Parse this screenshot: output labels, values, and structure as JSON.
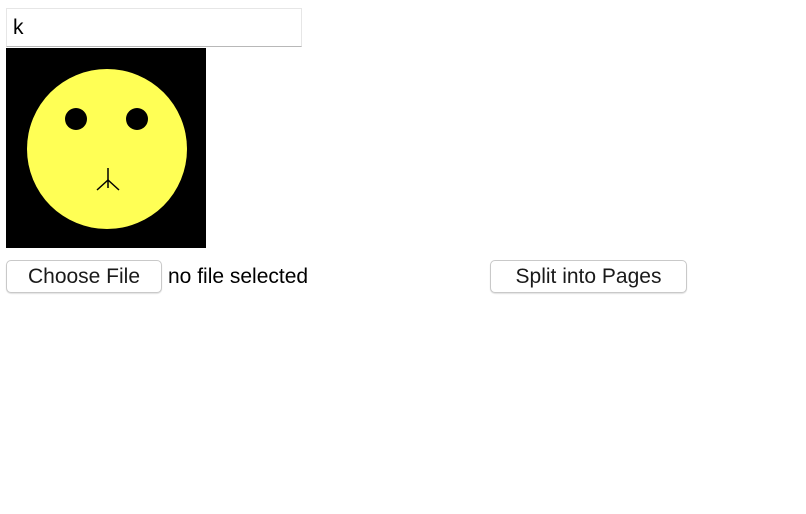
{
  "text_field": {
    "value": "k"
  },
  "image": {
    "icon": "smiley-face-icon",
    "background_color": "#000000",
    "face_color": "#ffff55"
  },
  "file_picker": {
    "button_label": "Choose File",
    "status_text": "no file selected"
  },
  "actions": {
    "split_label": "Split into Pages"
  }
}
